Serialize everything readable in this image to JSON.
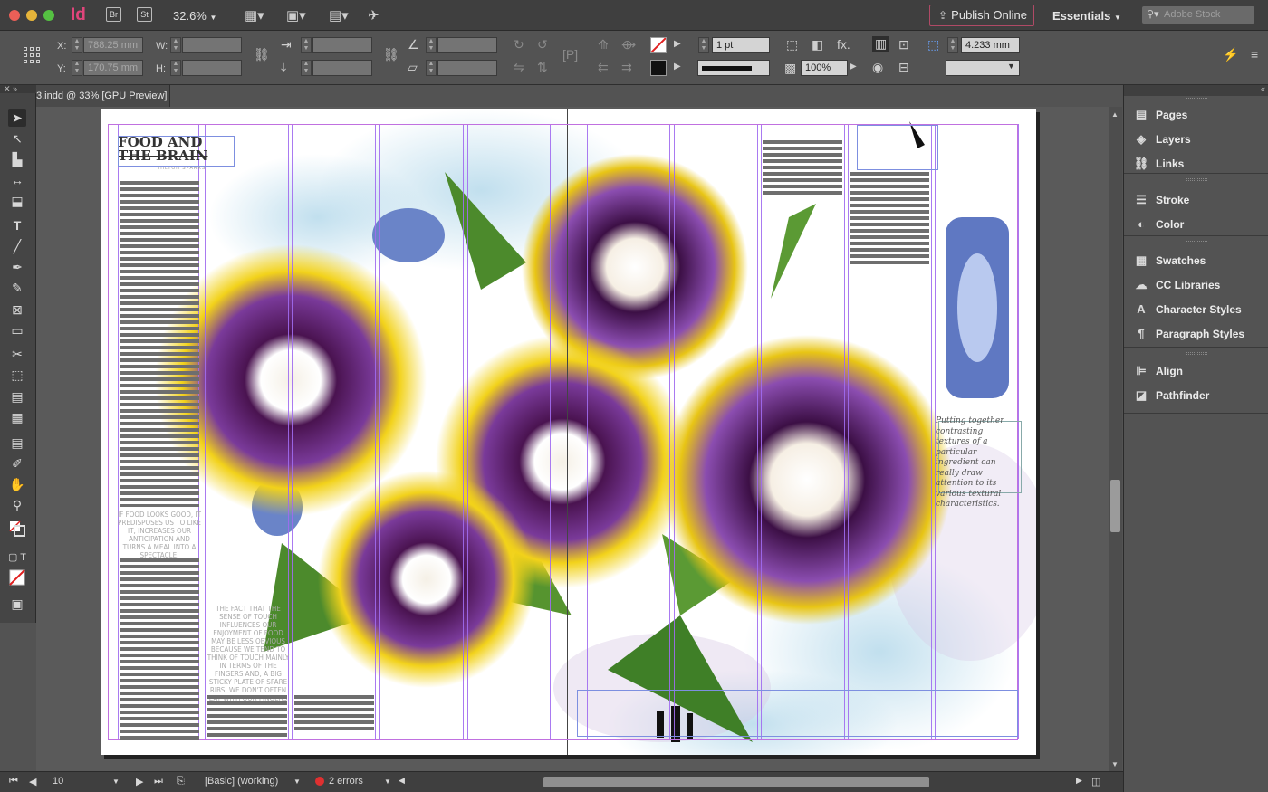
{
  "app": {
    "logo": "Id",
    "bridge": "Br",
    "stock": "St",
    "zoom": "32.6%",
    "publish_label": "Publish Online",
    "workspace": "Essentials",
    "search_placeholder": "Adobe Stock"
  },
  "control_panel": {
    "x_label": "X:",
    "x_value": "788.25 mm",
    "y_label": "Y:",
    "y_value": "170.75 mm",
    "w_label": "W:",
    "h_label": "H:",
    "stroke_weight": "1 pt",
    "opacity": "100%",
    "gap_value": "4.233 mm"
  },
  "document": {
    "tab_title": "3.indd @ 33% [GPU Preview]",
    "headline_line1": "FOOD AND",
    "headline_line2": "THE BRAIN",
    "byline": "HILTON SPARKS",
    "pull_quote_1": "IF FOOD LOOKS GOOD, IT PREDISPOSES US TO LIKE IT, INCREASES OUR ANTICIPATION AND TURNS A MEAL INTO A SPECTACLE.",
    "pull_quote_2": "THE FACT THAT THE SENSE OF TOUCH INFLUENCES OUR ENJOYMENT OF FOOD MAY BE LESS OBVIOUS BECAUSE WE TEND TO THINK OF TOUCH MAINLY IN TERMS OF THE FINGERS AND, A BIG STICKY PLATE OF SPARE RIBS, WE DON'T OFTEN EAT WITH OUR FINGERS",
    "caption": "Putting together contrasting textures of a particular ingredient can really draw attention to its various textural characteristics."
  },
  "status_bar": {
    "page_number": "10",
    "preflight_profile": "[Basic] (working)",
    "errors": "2 errors"
  },
  "panels": {
    "group1": [
      {
        "label": "Pages",
        "icon": "pages-icon"
      },
      {
        "label": "Layers",
        "icon": "layers-icon"
      },
      {
        "label": "Links",
        "icon": "links-icon"
      }
    ],
    "group2": [
      {
        "label": "Stroke",
        "icon": "stroke-icon"
      },
      {
        "label": "Color",
        "icon": "color-icon"
      }
    ],
    "group3": [
      {
        "label": "Swatches",
        "icon": "swatches-icon"
      },
      {
        "label": "CC Libraries",
        "icon": "cc-libraries-icon"
      },
      {
        "label": "Character Styles",
        "icon": "character-styles-icon"
      },
      {
        "label": "Paragraph Styles",
        "icon": "paragraph-styles-icon"
      }
    ],
    "group4": [
      {
        "label": "Align",
        "icon": "align-icon"
      },
      {
        "label": "Pathfinder",
        "icon": "pathfinder-icon"
      }
    ]
  },
  "colors": {
    "app_bg": "#535353",
    "accent_indesign": "#e0457b",
    "guide": "#a06cf0",
    "frame": "#7d8fe0"
  }
}
